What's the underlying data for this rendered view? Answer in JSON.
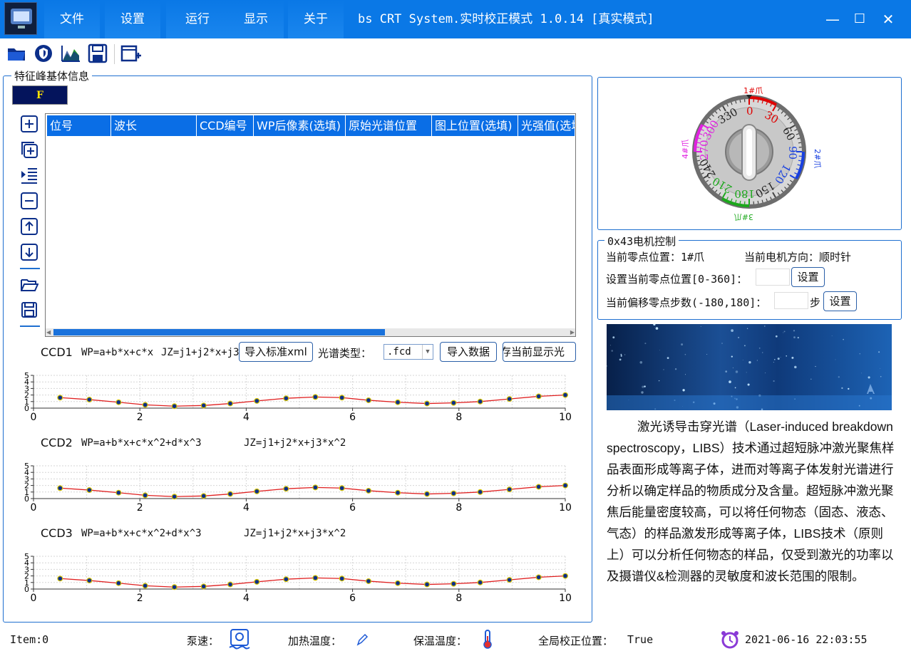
{
  "window": {
    "menu": [
      "文件",
      "设置",
      "运行",
      "显示",
      "关于"
    ],
    "title": "bs CRT System.实时校正模式 1.0.14 [真实模式]",
    "minimize": "—",
    "maximize": "☐",
    "close": "✕"
  },
  "left_panel": {
    "title": "特征峰基体信息",
    "badge": "F",
    "table": {
      "columns": [
        "位号",
        "波长",
        "CCD编号",
        "WP后像素(选填)",
        "原始光谱位置",
        "图上位置(选填)",
        "光强值(选填"
      ],
      "rows": []
    },
    "ccd_blocks": [
      {
        "label": "CCD1",
        "formula_wp": "WP=a+b*x+c*x",
        "formula_jz": "JZ=j1+j2*x+j3"
      },
      {
        "label": "CCD2",
        "formula_wp": "WP=a+b*x+c*x^2+d*x^3",
        "formula_jz": "JZ=j1+j2*x+j3*x^2"
      },
      {
        "label": "CCD3",
        "formula_wp": "WP=a+b*x+c*x^2+d*x^3",
        "formula_jz": "JZ=j1+j2*x+j3*x^2"
      }
    ],
    "controls": {
      "import_xml": "导入标准xml",
      "spectrum_type_label": "光谱类型：",
      "spectrum_type_value": ".fcd",
      "import_data": "导入数据",
      "save_display": "存当前显示光"
    }
  },
  "dial": {
    "claw1": "1#爪",
    "claw2": "2#爪",
    "claw3": "3#爪",
    "claw4": "4#爪",
    "labels": [
      "0",
      "30",
      "60",
      "90",
      "120",
      "150",
      "180",
      "210",
      "240",
      "270",
      "300",
      "330"
    ],
    "marks_red": [
      "0",
      "30"
    ],
    "marks_blue": [
      "90",
      "120"
    ],
    "marks_green": [
      "180",
      "210"
    ],
    "marks_magenta": [
      "270",
      "300"
    ]
  },
  "motor": {
    "title": "0x43电机控制",
    "zero_pos": "当前零点位置：1#爪",
    "direction": "当前电机方向：顺时针",
    "set_zero_label": "设置当前零点位置[0-360]：",
    "set_zero_btn": "设置",
    "offset_label": "当前偏移零点步数(-180,180]：",
    "step_unit": "步",
    "offset_btn": "设置"
  },
  "info": {
    "paragraph": "激光诱导击穿光谱（Laser-induced breakdown spectroscopy，LIBS）技术通过超短脉冲激光聚焦样品表面形成等离子体，进而对等离子体发射光谱进行分析以确定样品的物质成分及含量。超短脉冲激光聚焦后能量密度较高，可以将任何物态（固态、液态、气态）的样品激发形成等离子体，LIBS技术（原则上）可以分析任何物态的样品，仅受到激光的功率以及摄谱仪&检测器的灵敏度和波长范围的限制。"
  },
  "status": {
    "item": "Item:0",
    "pump": "泵速：",
    "heat": "加热温度：",
    "keep": "保温温度：",
    "global_label": "全局校正位置：",
    "global_value": "True",
    "datetime": "2021-06-16 22:03:55"
  },
  "chart_data": [
    {
      "type": "line",
      "name": "CCD1",
      "xlim": [
        0,
        10
      ],
      "ylim": [
        0,
        5
      ],
      "x_ticks": [
        "0",
        "2",
        "4",
        "6",
        "8",
        "10"
      ],
      "y_ticks": [
        "0",
        "1",
        "2",
        "3",
        "4",
        "5"
      ],
      "x": [
        0.5,
        1.05,
        1.6,
        2.1,
        2.65,
        3.2,
        3.7,
        4.2,
        4.75,
        5.3,
        5.8,
        6.3,
        6.85,
        7.4,
        7.9,
        8.4,
        8.95,
        9.5,
        10
      ],
      "y": [
        1.6,
        1.3,
        0.9,
        0.5,
        0.3,
        0.4,
        0.7,
        1.1,
        1.5,
        1.7,
        1.6,
        1.2,
        0.9,
        0.7,
        0.8,
        1.0,
        1.4,
        1.8,
        2.0
      ]
    },
    {
      "type": "line",
      "name": "CCD2",
      "xlim": [
        0,
        10
      ],
      "ylim": [
        0,
        5
      ],
      "x_ticks": [
        "0",
        "2",
        "4",
        "6",
        "8",
        "10"
      ],
      "y_ticks": [
        "0",
        "1",
        "2",
        "3",
        "4",
        "5"
      ],
      "x": [
        0.5,
        1.05,
        1.6,
        2.1,
        2.65,
        3.2,
        3.7,
        4.2,
        4.75,
        5.3,
        5.8,
        6.3,
        6.85,
        7.4,
        7.9,
        8.4,
        8.95,
        9.5,
        10
      ],
      "y": [
        1.6,
        1.3,
        0.9,
        0.5,
        0.3,
        0.4,
        0.7,
        1.1,
        1.5,
        1.7,
        1.6,
        1.2,
        0.9,
        0.7,
        0.8,
        1.0,
        1.4,
        1.8,
        2.0
      ]
    },
    {
      "type": "line",
      "name": "CCD3",
      "xlim": [
        0,
        10
      ],
      "ylim": [
        0,
        5
      ],
      "x_ticks": [
        "0",
        "2",
        "4",
        "6",
        "8",
        "10"
      ],
      "y_ticks": [
        "0",
        "1",
        "2",
        "3",
        "4",
        "5"
      ],
      "x": [
        0.5,
        1.05,
        1.6,
        2.1,
        2.65,
        3.2,
        3.7,
        4.2,
        4.75,
        5.3,
        5.8,
        6.3,
        6.85,
        7.4,
        7.9,
        8.4,
        8.95,
        9.5,
        10
      ],
      "y": [
        1.6,
        1.3,
        0.9,
        0.5,
        0.3,
        0.4,
        0.7,
        1.1,
        1.5,
        1.7,
        1.6,
        1.2,
        0.9,
        0.7,
        0.8,
        1.0,
        1.4,
        1.8,
        2.0
      ]
    }
  ]
}
